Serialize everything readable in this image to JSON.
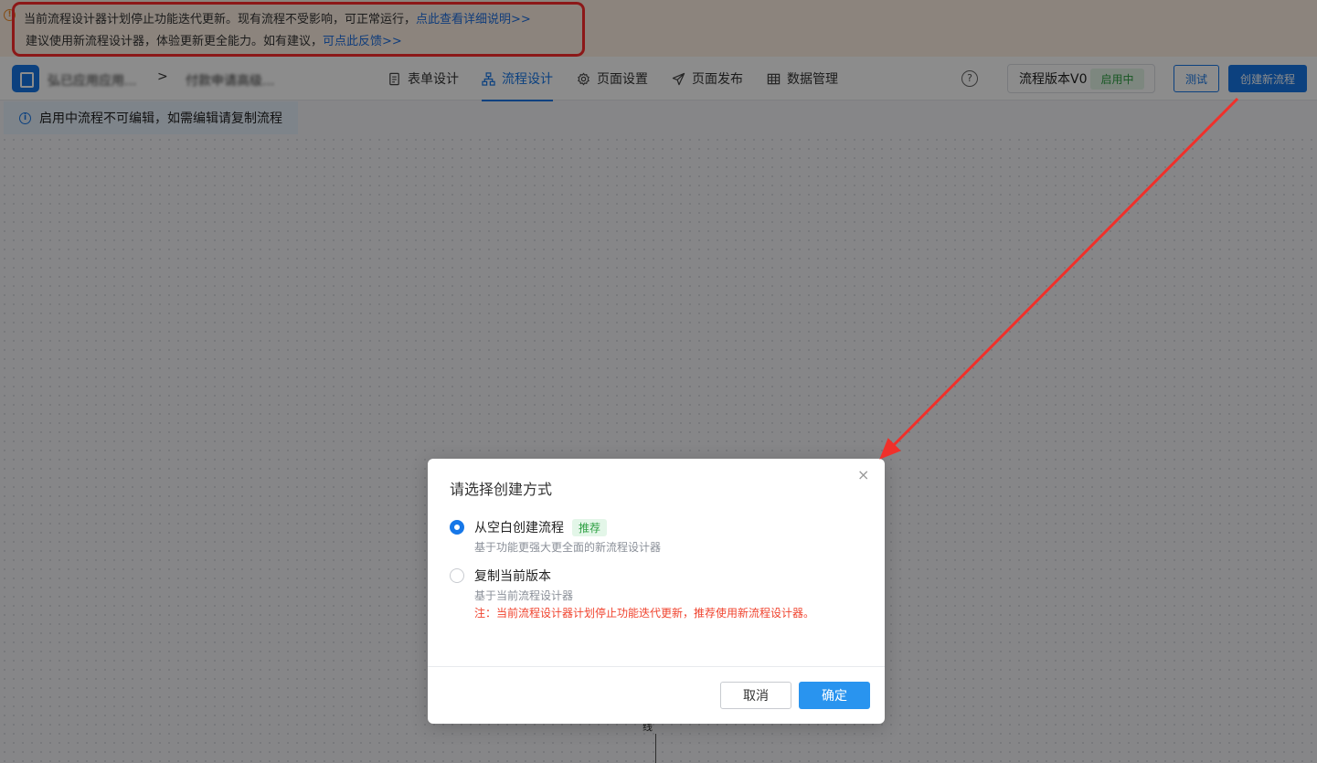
{
  "notice": {
    "line1_text": "当前流程设计器计划停止功能迭代更新。现有流程不受影响，可正常运行，",
    "line1_link": "点此查看详细说明>>",
    "line2_text": "建议使用新流程设计器，体验更新更全能力。如有建议，",
    "line2_link": "可点此反馈>>",
    "icon": "warning-circle-icon",
    "highlight_color": "#ff2d2d"
  },
  "header": {
    "app_name": "弘已应用应用...",
    "separator": ">",
    "form_name": "付款申请高级...",
    "tabs": [
      {
        "label": "表单设计",
        "icon": "document-icon",
        "active": false
      },
      {
        "label": "流程设计",
        "icon": "flowchart-icon",
        "active": true
      },
      {
        "label": "页面设置",
        "icon": "gear-icon",
        "active": false
      },
      {
        "label": "页面发布",
        "icon": "send-icon",
        "active": false
      },
      {
        "label": "数据管理",
        "icon": "table-icon",
        "active": false
      }
    ],
    "help_icon": "?",
    "version_label": "流程版本V0",
    "version_status": "启用中",
    "test_button": "测试",
    "create_button": "创建新流程",
    "accent_color": "#1677e8"
  },
  "info_bar": {
    "text": "启用中流程不可编辑，如需编辑请复制流程",
    "icon": "info-icon"
  },
  "canvas": {
    "node_label": "线"
  },
  "modal": {
    "title": "请选择创建方式",
    "close": "×",
    "options": [
      {
        "label": "从空白创建流程",
        "tag": "推荐",
        "description": "基于功能更强大更全面的新流程设计器",
        "selected": true
      },
      {
        "label": "复制当前版本",
        "description": "基于当前流程设计器",
        "note": "注：当前流程设计器计划停止功能迭代更新，推荐使用新流程设计器。",
        "selected": false
      }
    ],
    "cancel_button": "取消",
    "ok_button": "确定"
  }
}
